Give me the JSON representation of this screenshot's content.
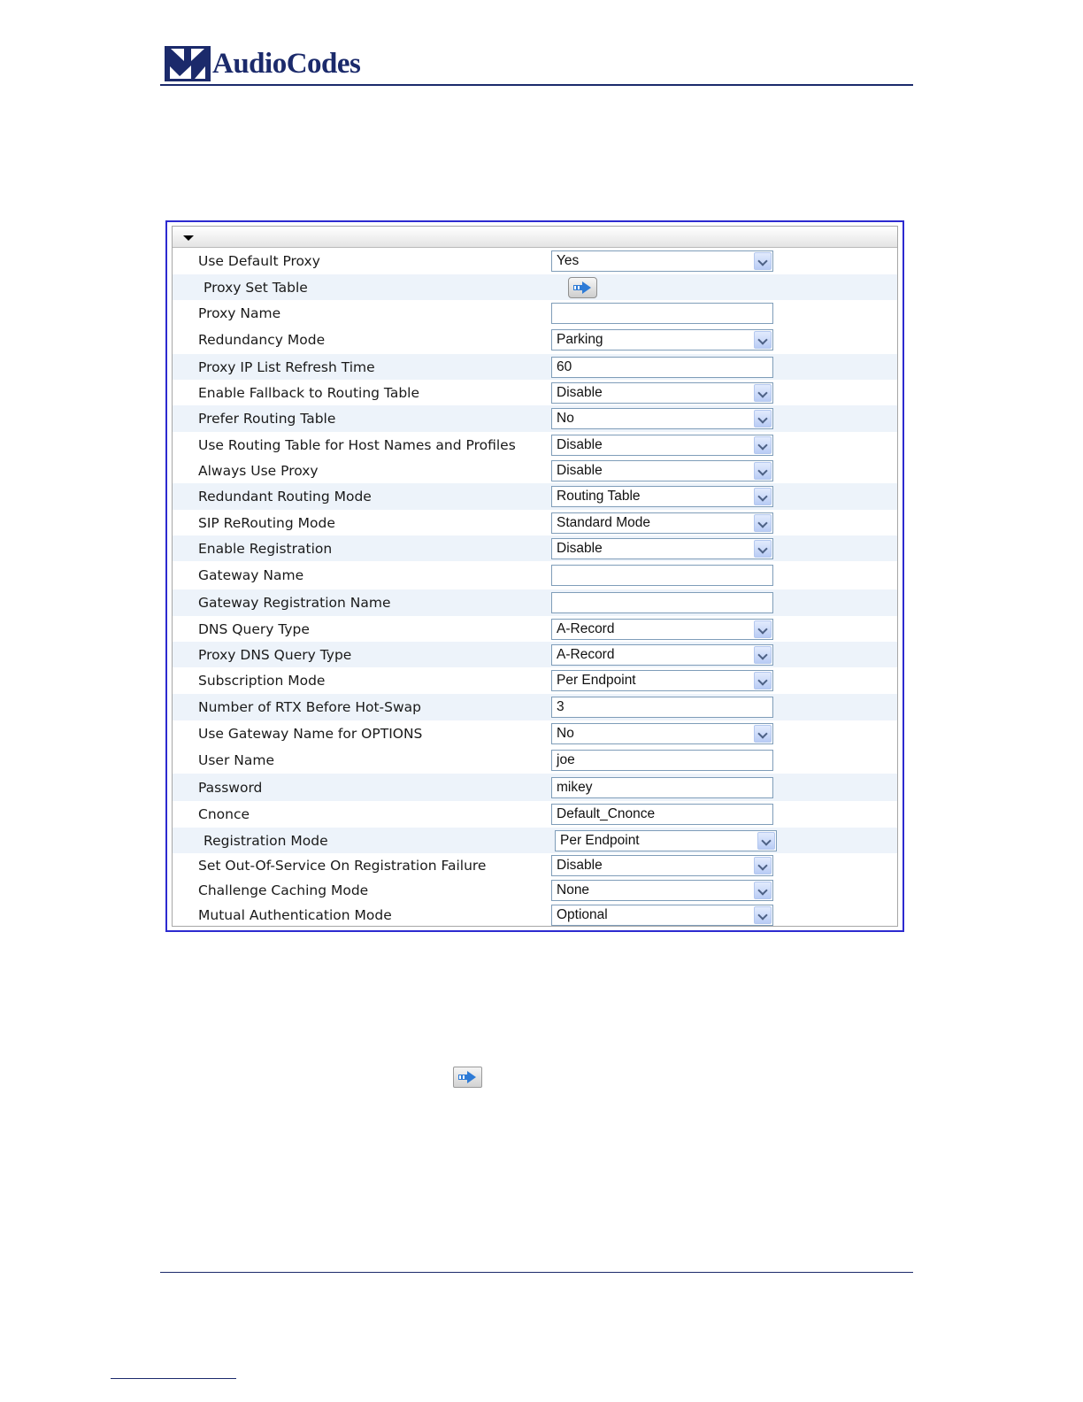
{
  "header": {
    "brand_name": "AudioCodes",
    "brand_color": "#1b2a6b"
  },
  "panel": {
    "collapse_icon": "collapse-arrow-icon",
    "border_color": "#2d2ad0",
    "rows": [
      {
        "label": "Use Default Proxy",
        "type": "select",
        "value": "Yes"
      },
      {
        "label": "Proxy Set Table",
        "type": "button",
        "icon": "arrow-right-icon"
      },
      {
        "label": "Proxy Name",
        "type": "text",
        "value": ""
      },
      {
        "label": "Redundancy Mode",
        "type": "select",
        "value": "Parking"
      },
      {
        "label": "Proxy IP List Refresh Time",
        "type": "text",
        "value": "60"
      },
      {
        "label": "Enable Fallback to Routing Table",
        "type": "select",
        "value": "Disable"
      },
      {
        "label": "Prefer Routing Table",
        "type": "select",
        "value": "No"
      },
      {
        "label": "Use Routing Table for Host Names and Profiles",
        "type": "select",
        "value": "Disable"
      },
      {
        "label": "Always Use Proxy",
        "type": "select",
        "value": "Disable"
      },
      {
        "label": "Redundant Routing Mode",
        "type": "select",
        "value": "Routing Table"
      },
      {
        "label": "SIP ReRouting Mode",
        "type": "select",
        "value": "Standard Mode"
      },
      {
        "label": "Enable Registration",
        "type": "select",
        "value": "Disable"
      },
      {
        "label": "Gateway Name",
        "type": "text",
        "value": ""
      },
      {
        "label": "Gateway Registration Name",
        "type": "text",
        "value": ""
      },
      {
        "label": "DNS Query Type",
        "type": "select",
        "value": "A-Record"
      },
      {
        "label": "Proxy DNS Query Type",
        "type": "select",
        "value": "A-Record"
      },
      {
        "label": "Subscription Mode",
        "type": "select",
        "value": "Per Endpoint"
      },
      {
        "label": "Number of RTX Before Hot-Swap",
        "type": "text",
        "value": "3"
      },
      {
        "label": "Use Gateway Name for OPTIONS",
        "type": "select",
        "value": "No"
      },
      {
        "label": "User Name",
        "type": "text",
        "value": "joe"
      },
      {
        "label": "Password",
        "type": "text",
        "value": "mikey"
      },
      {
        "label": "Cnonce",
        "type": "text",
        "value": "Default_Cnonce"
      },
      {
        "label": "Registration Mode",
        "type": "select",
        "value": "Per Endpoint"
      },
      {
        "label": "Set Out-Of-Service On Registration Failure",
        "type": "select",
        "value": "Disable"
      },
      {
        "label": "Challenge Caching Mode",
        "type": "select",
        "value": "None"
      },
      {
        "label": "Mutual Authentication Mode",
        "type": "select",
        "value": "Optional"
      }
    ]
  },
  "body_inline_icon": "arrow-right-icon"
}
